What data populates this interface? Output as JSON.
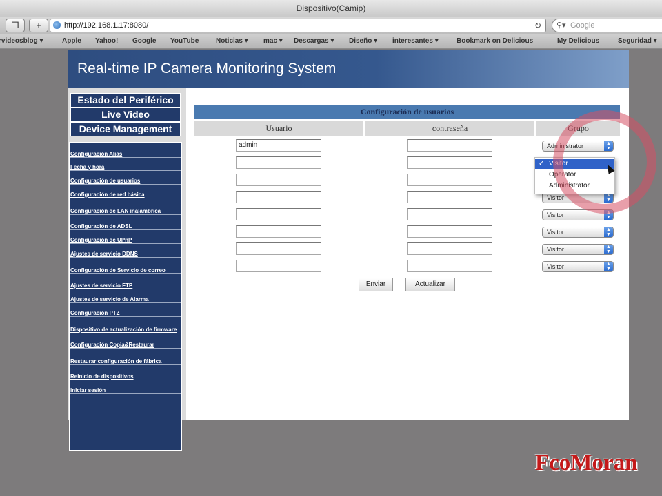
{
  "browser": {
    "window_title": "Dispositivo(Camip)",
    "url": "http://192.168.1.17:8080/",
    "search_placeholder": "Google",
    "bookmarks": [
      "rvideosblog ▾",
      "Apple",
      "Yahoo!",
      "Google",
      "YouTube",
      "Noticias ▾",
      "mac ▾",
      "Descargas ▾",
      "Diseño ▾",
      "interesantes ▾",
      "Bookmark on Delicious",
      "My Delicious",
      "Seguridad ▾"
    ]
  },
  "header": {
    "title": "Real-time IP Camera Monitoring System"
  },
  "sidebar": {
    "top_buttons": [
      "Estado del Periférico",
      "Live Video",
      "Device Management"
    ],
    "menu": [
      "Configuración Alias",
      "Fecha y hora",
      "Configuración de usuarios",
      "Configuración de red básica",
      "Configuración de LAN inalámbrica",
      "Configuración de ADSL",
      "Configuración de UPnP",
      "Ajustes de servicio DDNS",
      "Configuración de Servicio de correo",
      "Ajustes de servicio FTP",
      "Ajustes de servicio de Alarma",
      "Configuración PTZ",
      "Dispositivo de actualización de firmware",
      "Configuración Copia&Restaurar",
      "Restaurar configuración de fábrica",
      "Reinicio de dispositivos",
      "iniciar sesión"
    ]
  },
  "users": {
    "title": "Configuración de usuarios",
    "columns": [
      "Usuario",
      "contraseña",
      "Grupo"
    ],
    "rows": [
      {
        "user": "admin",
        "password": "",
        "group": "Administrator"
      },
      {
        "user": "",
        "password": "",
        "group": "Visitor"
      },
      {
        "user": "",
        "password": "",
        "group": "Visitor"
      },
      {
        "user": "",
        "password": "",
        "group": "Visitor"
      },
      {
        "user": "",
        "password": "",
        "group": "Visitor"
      },
      {
        "user": "",
        "password": "",
        "group": "Visitor"
      },
      {
        "user": "",
        "password": "",
        "group": "Visitor"
      },
      {
        "user": "",
        "password": "",
        "group": "Visitor"
      }
    ],
    "submit_label": "Enviar",
    "refresh_label": "Actualizar"
  },
  "group_dropdown": {
    "options": [
      "Visitor",
      "Operator",
      "Administrator"
    ],
    "selected": "Visitor",
    "check": "✓"
  },
  "watermark": "FcoMoran"
}
